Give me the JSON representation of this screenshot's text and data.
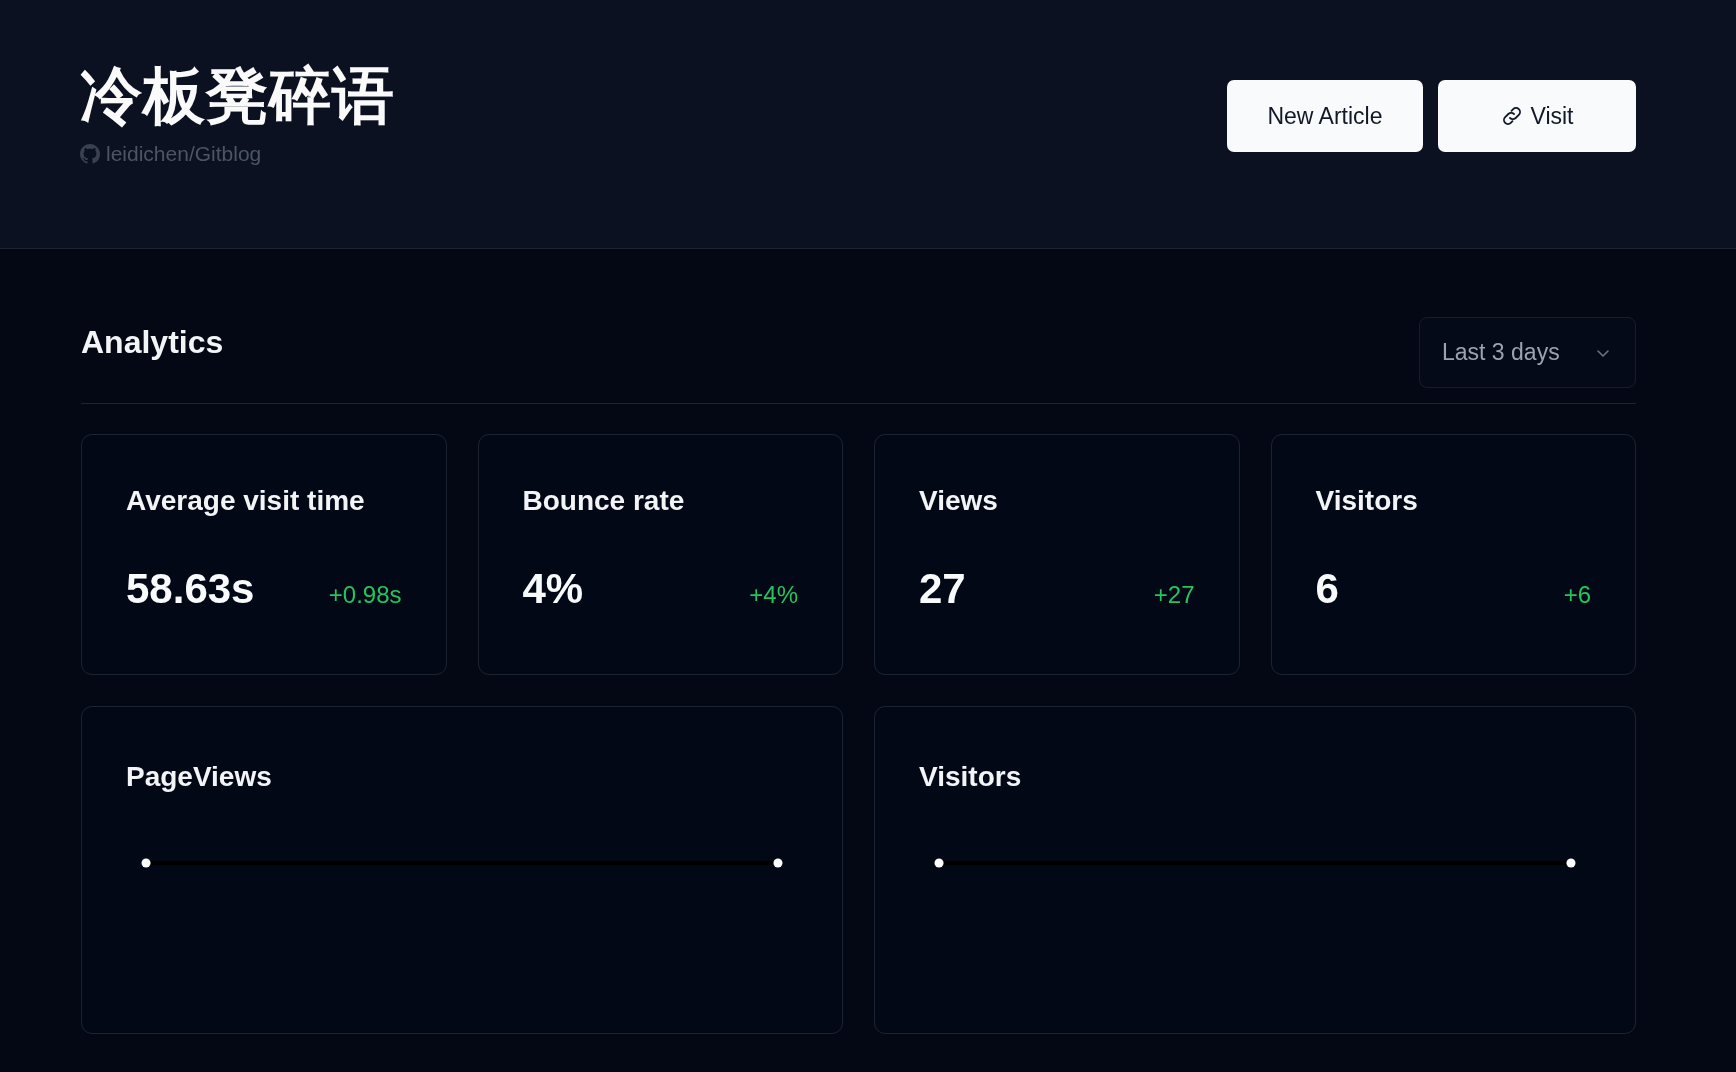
{
  "header": {
    "title": "冷板凳碎语",
    "repo": "leidichen/Gitblog",
    "buttons": [
      {
        "label": "New Article",
        "kind": "plain"
      },
      {
        "label": "Visit",
        "kind": "link"
      }
    ]
  },
  "analytics": {
    "title": "Analytics",
    "range": "Last 3 days"
  },
  "stats": [
    {
      "label": "Average visit time",
      "value": "58.63s",
      "delta": "+0.98s"
    },
    {
      "label": "Bounce rate",
      "value": "4%",
      "delta": "+4%"
    },
    {
      "label": "Views",
      "value": "27",
      "delta": "+27"
    },
    {
      "label": "Visitors",
      "value": "6",
      "delta": "+6"
    }
  ],
  "charts": [
    {
      "title": "PageViews"
    },
    {
      "title": "Visitors"
    }
  ]
}
